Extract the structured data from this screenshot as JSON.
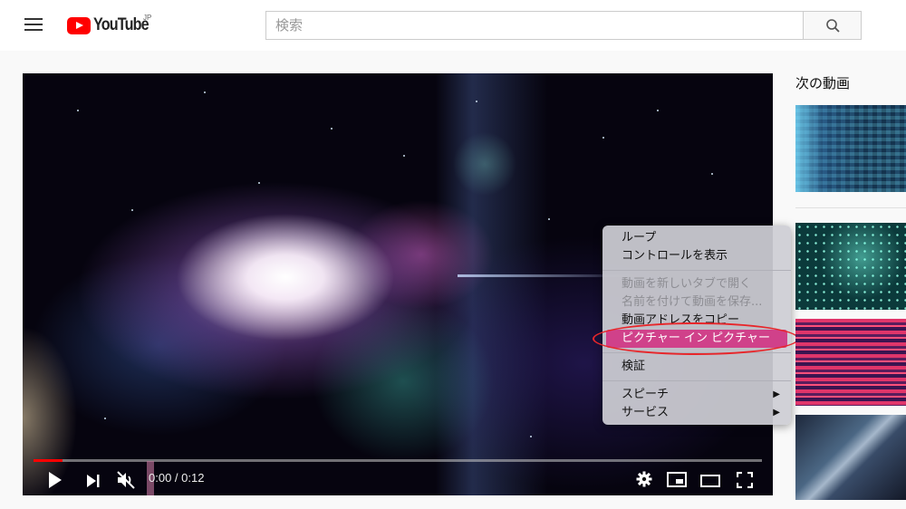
{
  "header": {
    "logo_text": "YouTube",
    "region": "JP",
    "search_placeholder": "検索",
    "brand_color": "#ff0000"
  },
  "player": {
    "current_time": "0:00",
    "duration": "0:12",
    "time_display": "0:00 / 0:12",
    "progress_fraction": 0.04,
    "muted": true
  },
  "context_menu": {
    "highlight_color": "#d0418a",
    "groups": [
      [
        {
          "label": "ループ",
          "enabled": true
        },
        {
          "label": "コントロールを表示",
          "enabled": true
        }
      ],
      [
        {
          "label": "動画を新しいタブで開く",
          "enabled": false
        },
        {
          "label": "名前を付けて動画を保存...",
          "enabled": false
        },
        {
          "label": "動画アドレスをコピー",
          "enabled": true
        },
        {
          "label": "ピクチャー イン ピクチャー",
          "enabled": true,
          "highlighted": true
        }
      ],
      [
        {
          "label": "検証",
          "enabled": true
        }
      ],
      [
        {
          "label": "スピーチ",
          "enabled": true,
          "submenu": true
        },
        {
          "label": "サービス",
          "enabled": true,
          "submenu": true
        }
      ]
    ],
    "submenu_arrow": "▶"
  },
  "annotation": {
    "color": "#e8262a"
  },
  "sidebar": {
    "title": "次の動画",
    "thumbnails": [
      "blue-mosaic-light",
      "teal-particles",
      "pink-light-streaks",
      "sci-fi-city"
    ]
  }
}
